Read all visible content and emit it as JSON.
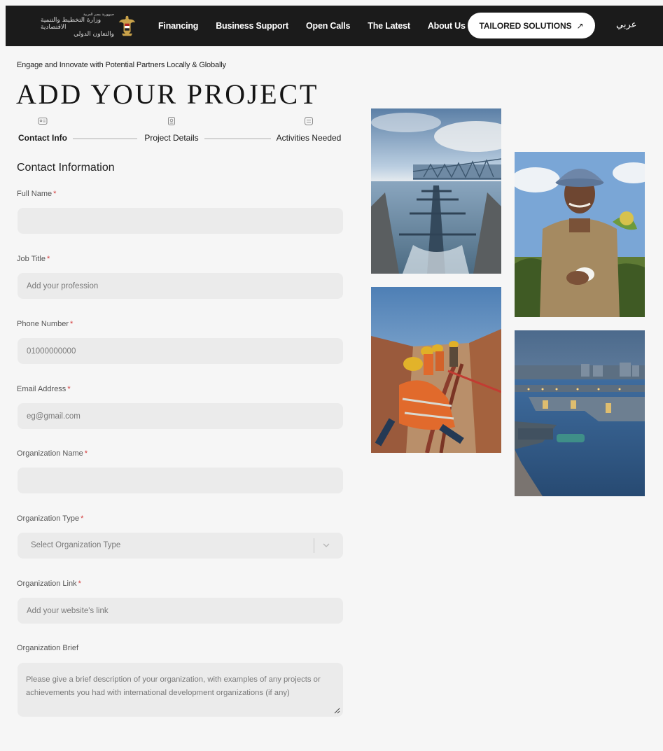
{
  "nav": {
    "logo_text": {
      "line1": "جمهورية مصر العربية",
      "line2": "وزارة التخطيط والتنمية الاقتصادية",
      "line3": "والتعاون الدولي"
    },
    "links": [
      "Financing",
      "Business Support",
      "Open Calls",
      "The Latest",
      "About Us"
    ],
    "cta_label": "TAILORED SOLUTIONS",
    "cta_arrow": "↗",
    "language_label": "عربي"
  },
  "header": {
    "tagline": "Engage and Innovate with Potential Partners Locally & Globally",
    "title": "ADD YOUR PROJECT"
  },
  "stepper": {
    "steps": [
      {
        "label": "Contact Info",
        "icon": "id-card-icon",
        "active": true
      },
      {
        "label": "Project Details",
        "icon": "document-icon",
        "active": false
      },
      {
        "label": "Activities Needed",
        "icon": "list-icon",
        "active": false
      }
    ]
  },
  "form": {
    "section_title": "Contact Information",
    "required_marker": "*",
    "fields": {
      "full_name": {
        "label": "Full Name",
        "placeholder": "",
        "required": true
      },
      "job_title": {
        "label": "Job Title",
        "placeholder": "Add your profession",
        "required": true
      },
      "phone": {
        "label": "Phone Number",
        "placeholder": "01000000000",
        "required": true
      },
      "email": {
        "label": "Email Address",
        "placeholder": "eg@gmail.com",
        "required": true
      },
      "org_name": {
        "label": "Organization Name",
        "placeholder": "",
        "required": true
      },
      "org_type": {
        "label": "Organization Type",
        "placeholder": "Select Organization Type",
        "required": true
      },
      "org_link": {
        "label": "Organization Link",
        "placeholder": "Add your website's link",
        "required": true
      },
      "org_brief": {
        "label": "Organization Brief",
        "placeholder": "Please give a brief description of your organization, with examples of any projects or achievements you had with international development organizations (if any)",
        "required": false
      }
    }
  },
  "colors": {
    "nav_bg": "#1b1b1b",
    "page_bg": "#f6f6f6",
    "input_bg": "#ebebeb",
    "required": "#d43a3a"
  }
}
